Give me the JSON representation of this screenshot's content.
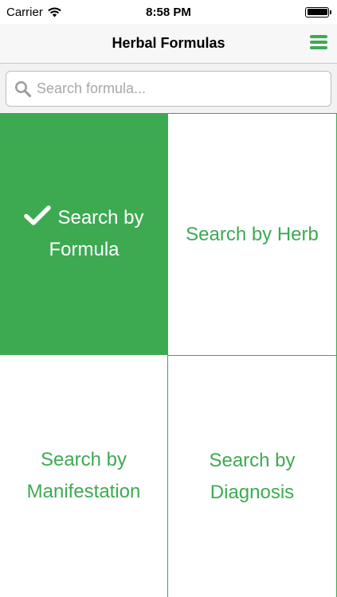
{
  "status_bar": {
    "carrier": "Carrier",
    "time": "8:58 PM"
  },
  "nav": {
    "title": "Herbal Formulas",
    "menu_icon": "hamburger-menu-icon"
  },
  "search": {
    "placeholder": "Search formula...",
    "value": "",
    "icon": "magnifier-icon"
  },
  "tiles": [
    {
      "line1": "Search by",
      "line2": "Formula",
      "selected": true,
      "icon": "checkmark-icon"
    },
    {
      "line1": "Search by Herb",
      "line2": "",
      "selected": false
    },
    {
      "line1": "Search by",
      "line2": "Manifestation",
      "selected": false
    },
    {
      "line1": "Search by",
      "line2": "Diagnosis",
      "selected": false
    }
  ],
  "colors": {
    "accent": "#3daa52",
    "nav_background": "#f7f7f7",
    "search_background": "#f2f2f2"
  }
}
